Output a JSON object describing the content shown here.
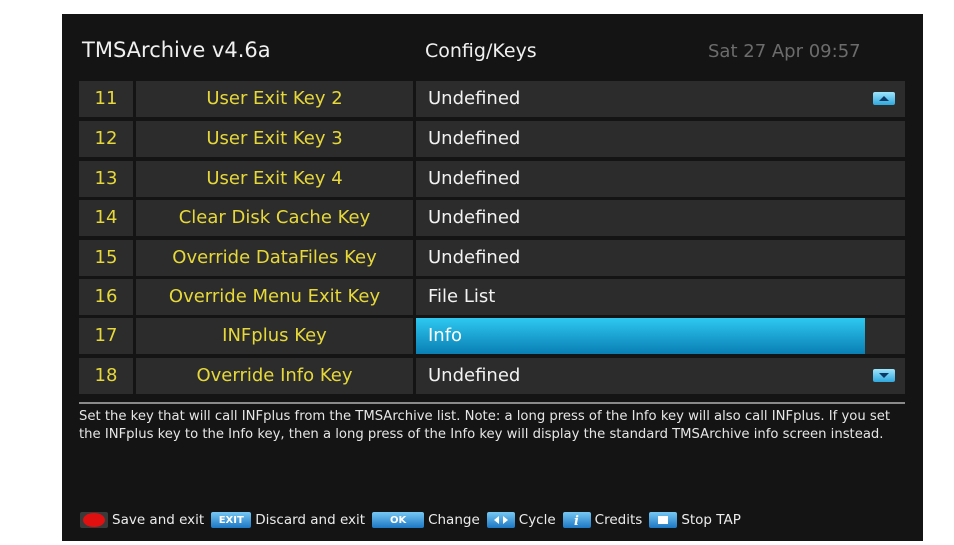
{
  "header": {
    "app_title": "TMSArchive v4.6a",
    "section_title": "Config/Keys",
    "clock": "Sat 27 Apr 09:57"
  },
  "rows": [
    {
      "num": "11",
      "label": "User Exit Key 2",
      "value": "Undefined"
    },
    {
      "num": "12",
      "label": "User Exit Key 3",
      "value": "Undefined"
    },
    {
      "num": "13",
      "label": "User Exit Key 4",
      "value": "Undefined"
    },
    {
      "num": "14",
      "label": "Clear Disk Cache Key",
      "value": "Undefined"
    },
    {
      "num": "15",
      "label": "Override DataFiles Key",
      "value": "Undefined"
    },
    {
      "num": "16",
      "label": "Override Menu Exit Key",
      "value": "File List"
    },
    {
      "num": "17",
      "label": "INFplus Key",
      "value": "Info",
      "selected": true
    },
    {
      "num": "18",
      "label": "Override Info Key",
      "value": "Undefined"
    }
  ],
  "help_text": "Set the key that will call INFplus from the TMSArchive list. Note: a long press of the Info key will also call INFplus. If you set the INFplus key to the Info key, then a long press of the Info key will display the standard TMSArchive info screen instead.",
  "footer": {
    "save": {
      "icon": "red-button-icon",
      "text": "Save and exit"
    },
    "exit": {
      "key": "EXIT",
      "text": "Discard and exit"
    },
    "ok": {
      "key": "OK",
      "text": "Change"
    },
    "cycle": {
      "icon": "left-right-arrows-icon",
      "text": "Cycle"
    },
    "credits": {
      "icon": "info-i-icon",
      "text": "Credits"
    },
    "stop": {
      "icon": "stop-square-icon",
      "text": "Stop TAP"
    }
  },
  "colors": {
    "label_yellow": "#e6d83a",
    "selection_blue": "#1ea4dc",
    "row_bg": "#2c2c2c",
    "screen_bg": "#141414"
  }
}
